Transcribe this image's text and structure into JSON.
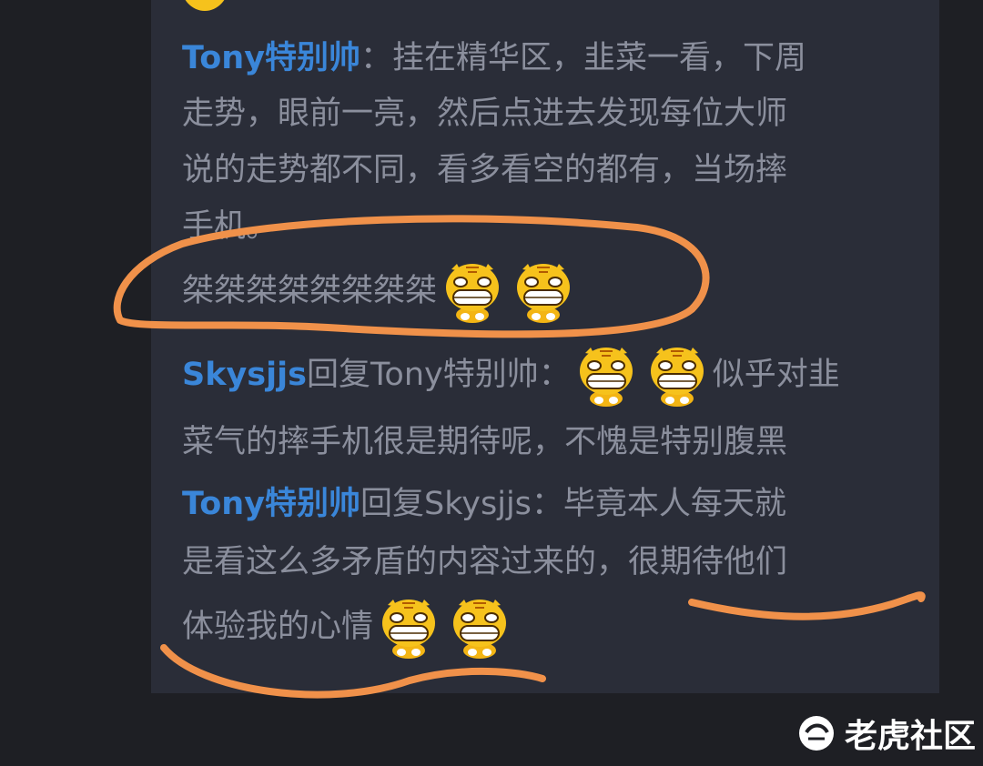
{
  "comments": {
    "first": {
      "author": "Tony特别帅",
      "separator": "：",
      "line1": "挂在精华区，韭菜一看，下周",
      "line2": "走势，眼前一亮，然后点进去发现每位大师",
      "line3": "说的走势都不同，看多看空的都有，当场摔",
      "line4": "手机。",
      "line5": "桀桀桀桀桀桀桀桀"
    },
    "reply1": {
      "author": "Skysjjs",
      "reply_word": "回复",
      "target": "Tony特别帅",
      "separator": "：",
      "text1": "似乎对韭",
      "line2": "菜气的摔手机很是期待呢，不愧是特别腹黑"
    },
    "reply2": {
      "author": "Tony特别帅",
      "reply_word": "回复",
      "target": "Skysjjs",
      "separator": "：",
      "text1": "毕竟本人每天就",
      "line2": "是看这么多矛盾的内容过来的，很期待他们",
      "line3": "体验我的心情"
    }
  },
  "watermark": {
    "text": "老虎社区",
    "logo_icon": "tiger-logo-icon"
  },
  "colors": {
    "username": "#3a86d9",
    "body_text": "#8b8f9d",
    "card_bg": "#2a2d38",
    "page_bg": "#1e1f24",
    "annotation": "#f0914a"
  }
}
